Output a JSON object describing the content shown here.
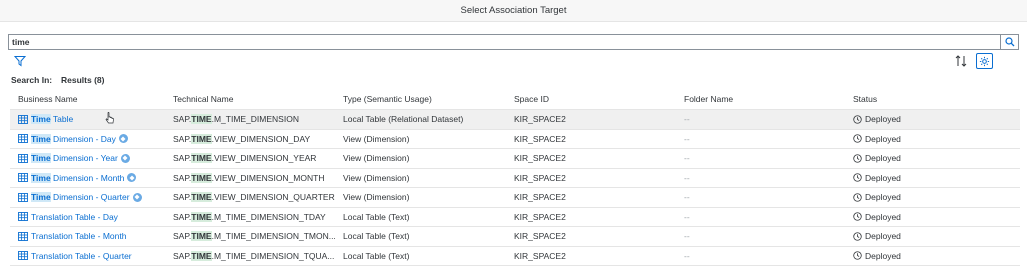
{
  "dialog": {
    "title": "Select Association Target"
  },
  "search": {
    "value": "time",
    "placeholder": ""
  },
  "toolbar": {
    "search_in_label": "Search In:",
    "results_label": "Results (8)"
  },
  "columns": [
    "Business Name",
    "Technical Name",
    "Type (Semantic Usage)",
    "Space ID",
    "Folder Name",
    "Status"
  ],
  "rows": [
    {
      "bn_pre": "",
      "bn_hl": "Time",
      "bn_post": " Table",
      "dim": false,
      "tn_pre": "SAP.",
      "tn_hl": "TIME",
      "tn_post": ".M_TIME_DIMENSION",
      "type": "Local Table (Relational Dataset)",
      "space": "KIR_SPACE2",
      "folder": "--",
      "status": "Deployed"
    },
    {
      "bn_pre": "",
      "bn_hl": "Time",
      "bn_post": " Dimension - Day",
      "dim": true,
      "tn_pre": "SAP.",
      "tn_hl": "TIME",
      "tn_post": ".VIEW_DIMENSION_DAY",
      "type": "View (Dimension)",
      "space": "KIR_SPACE2",
      "folder": "--",
      "status": "Deployed"
    },
    {
      "bn_pre": "",
      "bn_hl": "Time",
      "bn_post": " Dimension - Year",
      "dim": true,
      "tn_pre": "SAP.",
      "tn_hl": "TIME",
      "tn_post": ".VIEW_DIMENSION_YEAR",
      "type": "View (Dimension)",
      "space": "KIR_SPACE2",
      "folder": "--",
      "status": "Deployed"
    },
    {
      "bn_pre": "",
      "bn_hl": "Time",
      "bn_post": " Dimension - Month",
      "dim": true,
      "tn_pre": "SAP.",
      "tn_hl": "TIME",
      "tn_post": ".VIEW_DIMENSION_MONTH",
      "type": "View (Dimension)",
      "space": "KIR_SPACE2",
      "folder": "--",
      "status": "Deployed"
    },
    {
      "bn_pre": "",
      "bn_hl": "Time",
      "bn_post": " Dimension - Quarter",
      "dim": true,
      "tn_pre": "SAP.",
      "tn_hl": "TIME",
      "tn_post": ".VIEW_DIMENSION_QUARTER",
      "type": "View (Dimension)",
      "space": "KIR_SPACE2",
      "folder": "--",
      "status": "Deployed"
    },
    {
      "bn_pre": "Translation Table - Day",
      "bn_hl": "",
      "bn_post": "",
      "dim": false,
      "tn_pre": "SAP.",
      "tn_hl": "TIME",
      "tn_post": ".M_TIME_DIMENSION_TDAY",
      "type": "Local Table (Text)",
      "space": "KIR_SPACE2",
      "folder": "--",
      "status": "Deployed"
    },
    {
      "bn_pre": "Translation Table - Month",
      "bn_hl": "",
      "bn_post": "",
      "dim": false,
      "tn_pre": "SAP.",
      "tn_hl": "TIME",
      "tn_post": ".M_TIME_DIMENSION_TMON...",
      "type": "Local Table (Text)",
      "space": "KIR_SPACE2",
      "folder": "--",
      "status": "Deployed"
    },
    {
      "bn_pre": "Translation Table - Quarter",
      "bn_hl": "",
      "bn_post": "",
      "dim": false,
      "tn_pre": "SAP.",
      "tn_hl": "TIME",
      "tn_post": ".M_TIME_DIMENSION_TQUA...",
      "type": "Local Table (Text)",
      "space": "KIR_SPACE2",
      "folder": "--",
      "status": "Deployed"
    }
  ],
  "colors": {
    "link": "#0a6ed1",
    "highlight": "#cfe8f7",
    "selected_row": "#f0f0f0"
  }
}
